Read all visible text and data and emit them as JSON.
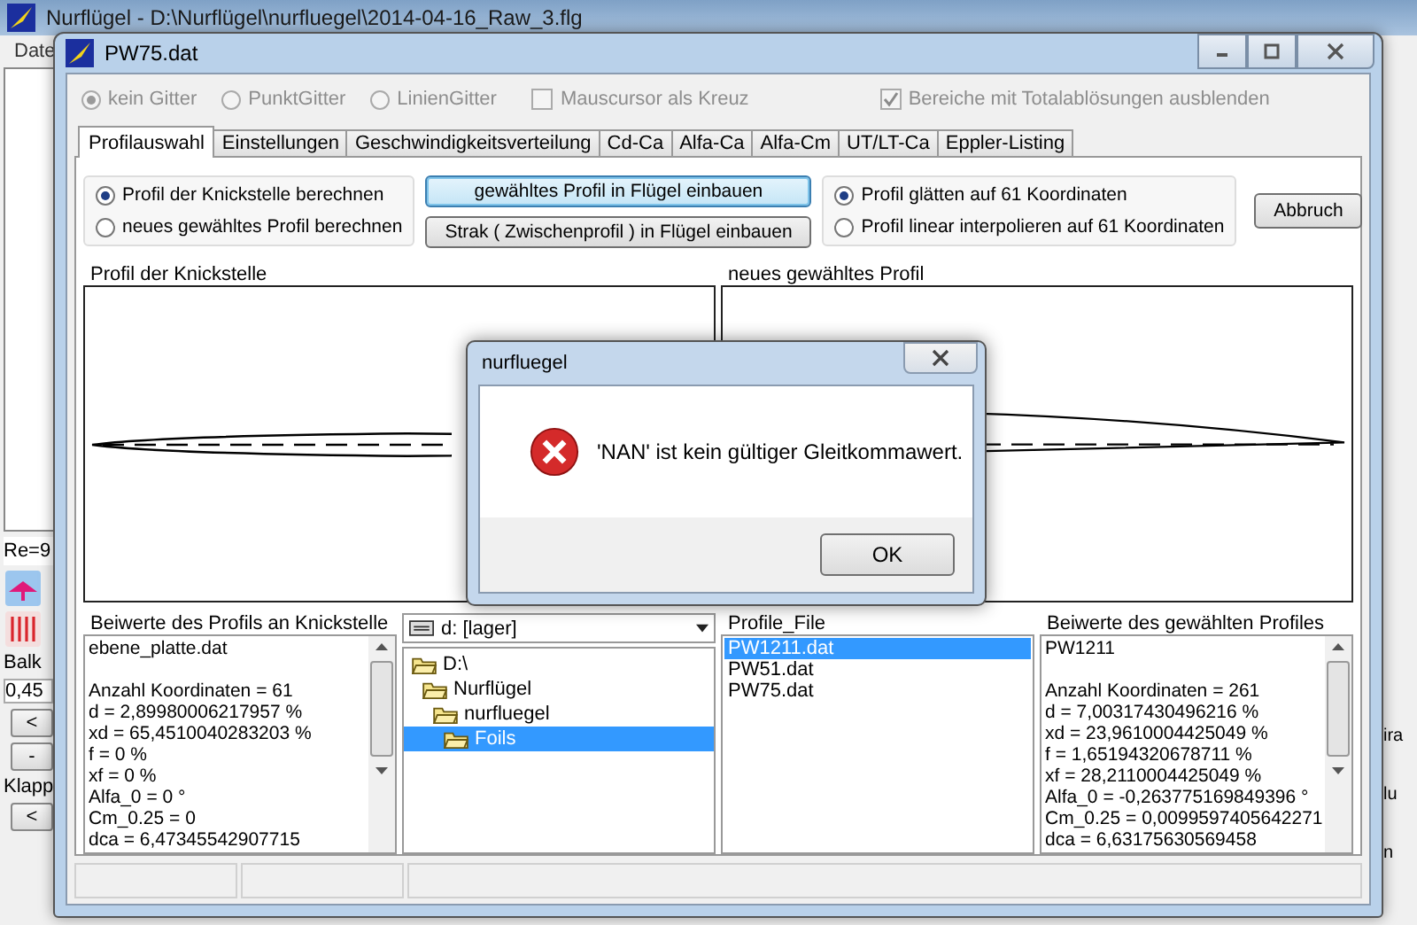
{
  "app_window": {
    "title": "Nurflügel - D:\\Nurflügel\\nurfluegel\\2014-04-16_Raw_3.flg",
    "menu": [
      "Date"
    ],
    "left_panel": {
      "reynolds": "Re=9",
      "balken_label": "Balk",
      "balken_value": "0,45",
      "buttons": [
        "<",
        "-"
      ],
      "klappen_label": "Klapp",
      "klappen_buttons": [
        "<"
      ]
    },
    "right_fragments": [
      "ira",
      "lu",
      "n"
    ]
  },
  "dialog": {
    "title": "PW75.dat",
    "options": [
      {
        "kind": "radio",
        "label": "kein Gitter",
        "selected": true,
        "disabled": true
      },
      {
        "kind": "radio",
        "label": "PunktGitter",
        "selected": false,
        "disabled": true
      },
      {
        "kind": "radio",
        "label": "LinienGitter",
        "selected": false,
        "disabled": true
      },
      {
        "kind": "checkbox",
        "label": "Mauscursor als Kreuz",
        "checked": false,
        "disabled": true
      },
      {
        "kind": "checkbox",
        "label": "Bereiche mit Totalablösungen ausblenden",
        "checked": true,
        "disabled": true
      }
    ],
    "tabs": [
      {
        "label": "Profilauswahl",
        "selected": true
      },
      {
        "label": "Einstellungen",
        "selected": false
      },
      {
        "label": "Geschwindigkeitsverteilung",
        "selected": false
      },
      {
        "label": "Cd-Ca",
        "selected": false
      },
      {
        "label": "Alfa-Ca",
        "selected": false
      },
      {
        "label": "Alfa-Cm",
        "selected": false
      },
      {
        "label": "UT/LT-Ca",
        "selected": false
      },
      {
        "label": "Eppler-Listing",
        "selected": false
      }
    ],
    "mode_radios": [
      {
        "label": "Profil der Knickstelle berechnen",
        "selected": true
      },
      {
        "label": "neues gewähltes Profil berechnen",
        "selected": false
      }
    ],
    "action_buttons": [
      {
        "label": "gewähltes Profil in Flügel einbauen",
        "focused": true
      },
      {
        "label": "Strak ( Zwischenprofil ) in Flügel einbauen",
        "focused": false
      }
    ],
    "smooth_radios": [
      {
        "label": "Profil glätten auf 61 Koordinaten",
        "selected": true
      },
      {
        "label": "Profil linear interpolieren auf 61 Koordinaten",
        "selected": false
      }
    ],
    "cancel_button": "Abbruch",
    "plots": [
      {
        "title": "Profil der Knickstelle"
      },
      {
        "title": "neues gewähltes Profil"
      }
    ],
    "left_memo": {
      "title": "Beiwerte des Profils an Knickstelle",
      "name": "ebene_platte.dat",
      "lines": [
        "Anzahl Koordinaten = 61",
        "d = 2,89980006217957 %",
        "xd = 65,4510040283203 %",
        "f = 0 %",
        "xf = 0 %",
        "Alfa_0 = 0 °",
        "Cm_0.25 = 0",
        "dca = 6,47345542907715"
      ]
    },
    "drive": "d: [lager]",
    "folders": [
      {
        "name": "D:\\",
        "selected": false,
        "children": [
          {
            "name": "Nurflügel",
            "selected": false,
            "children": [
              {
                "name": "nurfluegel",
                "selected": false,
                "children": [
                  {
                    "name": "Foils",
                    "selected": true
                  }
                ]
              }
            ]
          }
        ]
      }
    ],
    "file_list": {
      "title": "Profile_File",
      "items": [
        {
          "name": "PW1211.dat",
          "selected": true
        },
        {
          "name": "PW51.dat",
          "selected": false
        },
        {
          "name": "PW75.dat",
          "selected": false
        }
      ]
    },
    "right_memo": {
      "title": "Beiwerte des gewählten Profiles",
      "name": "PW1211",
      "lines": [
        "Anzahl Koordinaten = 261",
        "d = 7,00317430496216 %",
        "xd = 23,9610004425049 %",
        "f = 1,65194320678711 %",
        "xf = 28,2110004425049 %",
        "Alfa_0 = -0,263775169849396 °",
        "Cm_0.25 = 0,0099597405642271",
        "dca = 6,63175630569458"
      ]
    }
  },
  "message_box": {
    "title": "nurfluegel",
    "message": "'NAN' ist kein gültiger Gleitkommawert.",
    "button": "OK"
  }
}
